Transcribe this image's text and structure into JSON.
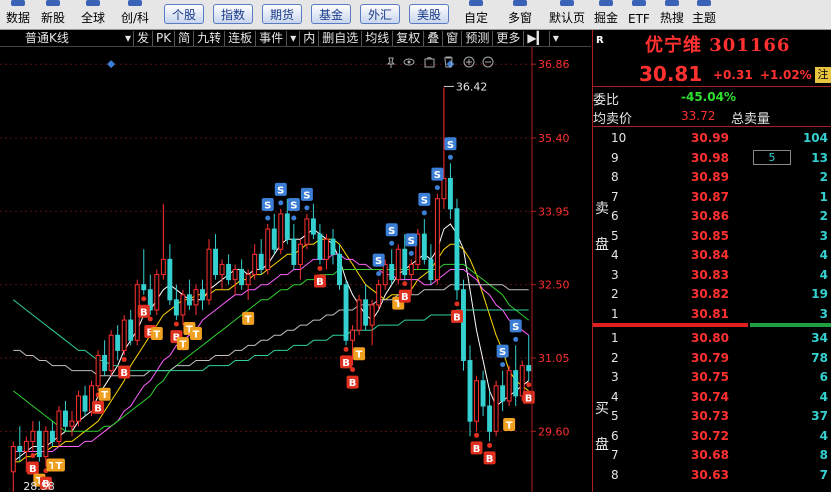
{
  "toolbar": {
    "left_items": [
      "数据",
      "新股",
      "全球",
      "创/科"
    ],
    "tabs": [
      "个股",
      "指数",
      "期货",
      "基金",
      "外汇",
      "美股"
    ],
    "right_items": [
      "自定",
      "多窗",
      "默认页",
      "掘金",
      "ETF",
      "热搜",
      "主题"
    ]
  },
  "chart_toolbar": [
    "普通K线",
    "发",
    "PK",
    "简",
    "九转",
    "连板",
    "事件",
    "内",
    "删自选",
    "均线",
    "复权",
    "叠",
    "窗",
    "预测",
    "更多"
  ],
  "chart_icons": [
    "pin-icon",
    "eye-icon",
    "bag-icon",
    "trash-icon",
    "add-icon",
    "remove-icon"
  ],
  "stock": {
    "flag": "R",
    "name": "优宁维 301166",
    "price": "30.81",
    "change": "+0.31",
    "change_pct": "+1.02%",
    "margin_badge": "注",
    "weibi_label": "委比",
    "weibi_value": "-45.04%",
    "avg_label": "均卖价",
    "avg_value": "33.72",
    "total_label": "总卖量"
  },
  "order_book": {
    "sell_label": [
      "卖",
      "盘"
    ],
    "buy_label": [
      "买",
      "盘"
    ],
    "asks": [
      {
        "level": "10",
        "price": "30.99",
        "vol": "104"
      },
      {
        "level": "9",
        "price": "30.98",
        "vol": "13",
        "box": "5"
      },
      {
        "level": "8",
        "price": "30.89",
        "vol": "2"
      },
      {
        "level": "7",
        "price": "30.87",
        "vol": "1"
      },
      {
        "level": "6",
        "price": "30.86",
        "vol": "2"
      },
      {
        "level": "5",
        "price": "30.85",
        "vol": "3"
      },
      {
        "level": "4",
        "price": "30.84",
        "vol": "4"
      },
      {
        "level": "3",
        "price": "30.83",
        "vol": "4"
      },
      {
        "level": "2",
        "price": "30.82",
        "vol": "19"
      },
      {
        "level": "1",
        "price": "30.81",
        "vol": "3"
      }
    ],
    "bids": [
      {
        "level": "1",
        "price": "30.80",
        "vol": "34"
      },
      {
        "level": "2",
        "price": "30.79",
        "vol": "78"
      },
      {
        "level": "3",
        "price": "30.75",
        "vol": "6"
      },
      {
        "level": "4",
        "price": "30.74",
        "vol": "4"
      },
      {
        "level": "5",
        "price": "30.73",
        "vol": "37"
      },
      {
        "level": "6",
        "price": "30.72",
        "vol": "4"
      },
      {
        "level": "7",
        "price": "30.68",
        "vol": "8"
      },
      {
        "level": "8",
        "price": "30.63",
        "vol": "7"
      }
    ]
  },
  "chart_data": {
    "type": "candlestick",
    "y_ticks": [
      "36.86",
      "35.40",
      "33.95",
      "32.50",
      "31.05",
      "29.60"
    ],
    "ylim": [
      28.4,
      37.2
    ],
    "high_label": "36.42",
    "low_label": "28.58",
    "high_value": 36.42,
    "low_value": 28.58,
    "colors": {
      "up": "#ff3030",
      "down": "#35d0d0",
      "ma5": "#ffffff",
      "ma10": "#ffd700",
      "ma20": "#ff60ff",
      "ma30": "#30d030",
      "ma60": "#c0c0c0",
      "ma120": "#30d0a0"
    },
    "ohlc": [
      [
        28.8,
        29.4,
        28.4,
        29.3
      ],
      [
        29.3,
        29.7,
        29.0,
        29.2
      ],
      [
        29.2,
        29.5,
        28.8,
        29.4
      ],
      [
        29.4,
        29.8,
        29.2,
        29.6
      ],
      [
        29.6,
        29.8,
        29.0,
        29.1
      ],
      [
        29.1,
        29.7,
        28.9,
        29.6
      ],
      [
        29.6,
        29.8,
        29.3,
        29.4
      ],
      [
        29.4,
        30.1,
        29.3,
        30.0
      ],
      [
        30.0,
        30.2,
        29.6,
        29.7
      ],
      [
        29.7,
        30.0,
        29.5,
        29.8
      ],
      [
        29.8,
        30.4,
        29.7,
        30.3
      ],
      [
        30.3,
        30.5,
        29.9,
        30.0
      ],
      [
        30.0,
        30.6,
        29.9,
        30.5
      ],
      [
        30.5,
        31.2,
        30.4,
        31.1
      ],
      [
        31.1,
        31.4,
        30.7,
        30.8
      ],
      [
        30.8,
        31.6,
        30.7,
        31.5
      ],
      [
        31.5,
        31.7,
        31.0,
        31.2
      ],
      [
        31.2,
        31.9,
        31.1,
        31.8
      ],
      [
        31.8,
        32.0,
        31.3,
        31.4
      ],
      [
        31.4,
        32.6,
        31.3,
        32.5
      ],
      [
        32.5,
        33.2,
        32.3,
        32.4
      ],
      [
        32.4,
        32.7,
        31.9,
        32.0
      ],
      [
        32.0,
        32.8,
        31.9,
        32.7
      ],
      [
        32.7,
        34.1,
        32.6,
        33.0
      ],
      [
        33.0,
        33.3,
        32.1,
        32.2
      ],
      [
        32.2,
        32.5,
        31.8,
        31.9
      ],
      [
        31.9,
        32.4,
        31.7,
        32.3
      ],
      [
        32.3,
        32.6,
        32.0,
        32.1
      ],
      [
        32.1,
        32.5,
        31.9,
        32.4
      ],
      [
        32.4,
        32.6,
        32.0,
        32.2
      ],
      [
        32.2,
        33.4,
        32.1,
        33.2
      ],
      [
        33.2,
        33.5,
        32.6,
        32.7
      ],
      [
        32.7,
        33.0,
        32.4,
        32.9
      ],
      [
        32.9,
        33.1,
        32.5,
        32.6
      ],
      [
        32.6,
        32.9,
        32.3,
        32.8
      ],
      [
        32.8,
        33.0,
        32.4,
        32.5
      ],
      [
        32.5,
        32.8,
        32.2,
        32.7
      ],
      [
        32.7,
        33.3,
        32.6,
        33.1
      ],
      [
        33.1,
        33.4,
        32.7,
        32.8
      ],
      [
        32.8,
        33.7,
        32.7,
        33.6
      ],
      [
        33.6,
        33.9,
        33.1,
        33.2
      ],
      [
        33.2,
        34.0,
        33.1,
        33.9
      ],
      [
        33.9,
        34.2,
        33.3,
        33.4
      ],
      [
        33.4,
        33.7,
        32.8,
        32.9
      ],
      [
        32.9,
        33.4,
        32.6,
        33.3
      ],
      [
        33.3,
        33.9,
        33.2,
        33.8
      ],
      [
        33.8,
        34.1,
        33.4,
        33.5
      ],
      [
        33.5,
        33.7,
        32.9,
        33.0
      ],
      [
        33.0,
        33.5,
        32.8,
        33.4
      ],
      [
        33.4,
        33.6,
        32.9,
        33.1
      ],
      [
        33.1,
        33.3,
        32.4,
        32.5
      ],
      [
        32.5,
        32.6,
        31.3,
        31.4
      ],
      [
        31.4,
        31.7,
        30.9,
        31.6
      ],
      [
        31.6,
        32.3,
        31.5,
        32.2
      ],
      [
        32.2,
        32.5,
        31.6,
        31.7
      ],
      [
        31.7,
        32.2,
        31.3,
        32.1
      ],
      [
        32.1,
        32.6,
        32.0,
        32.5
      ],
      [
        32.5,
        33.0,
        32.4,
        32.9
      ],
      [
        32.9,
        33.2,
        32.5,
        32.6
      ],
      [
        32.6,
        33.3,
        32.5,
        33.2
      ],
      [
        33.2,
        33.5,
        32.6,
        32.7
      ],
      [
        32.7,
        33.0,
        32.3,
        32.9
      ],
      [
        32.9,
        33.6,
        32.8,
        33.5
      ],
      [
        33.5,
        33.8,
        32.9,
        33.0
      ],
      [
        33.0,
        33.3,
        32.5,
        32.6
      ],
      [
        32.6,
        34.3,
        32.5,
        34.2
      ],
      [
        34.2,
        36.4,
        34.0,
        34.6
      ],
      [
        34.6,
        34.9,
        33.8,
        34.0
      ],
      [
        34.0,
        34.2,
        32.2,
        32.4
      ],
      [
        32.4,
        32.6,
        30.8,
        31.0
      ],
      [
        31.0,
        31.3,
        29.5,
        29.8
      ],
      [
        29.8,
        30.7,
        29.6,
        30.6
      ],
      [
        30.6,
        30.8,
        29.9,
        30.1
      ],
      [
        30.1,
        30.4,
        29.4,
        29.6
      ],
      [
        29.6,
        30.6,
        29.5,
        30.5
      ],
      [
        30.5,
        30.8,
        30.0,
        30.2
      ],
      [
        30.2,
        30.9,
        30.1,
        30.8
      ],
      [
        30.8,
        31.3,
        30.1,
        30.3
      ],
      [
        30.3,
        31.0,
        30.2,
        30.9
      ],
      [
        30.9,
        31.5,
        30.6,
        30.8
      ]
    ],
    "ma_series": [
      {
        "name": "MA5",
        "color": "#ffffff",
        "values": [
          29.0,
          29.1,
          29.2,
          29.3,
          29.3,
          29.3,
          29.4,
          29.5,
          29.6,
          29.6,
          29.8,
          29.9,
          30.0,
          30.3,
          30.5,
          30.7,
          30.9,
          31.2,
          31.4,
          31.6,
          31.9,
          32.0,
          32.2,
          32.4,
          32.5,
          32.4,
          32.3,
          32.2,
          32.2,
          32.2,
          32.4,
          32.5,
          32.6,
          32.7,
          32.8,
          32.8,
          32.7,
          32.8,
          32.8,
          32.9,
          33.1,
          33.3,
          33.4,
          33.4,
          33.4,
          33.5,
          33.6,
          33.5,
          33.4,
          33.3,
          33.0,
          32.6,
          32.3,
          32.1,
          31.9,
          31.8,
          32.0,
          32.3,
          32.5,
          32.7,
          32.8,
          32.9,
          33.0,
          33.1,
          33.0,
          33.2,
          33.6,
          33.7,
          33.5,
          33.2,
          32.4,
          31.6,
          31.0,
          30.4,
          30.1,
          30.2,
          30.3,
          30.4,
          30.5,
          30.6
        ]
      },
      {
        "name": "MA10",
        "color": "#ffd700",
        "values": [
          29.0,
          29.0,
          29.1,
          29.1,
          29.2,
          29.2,
          29.3,
          29.3,
          29.4,
          29.4,
          29.5,
          29.6,
          29.7,
          29.8,
          30.0,
          30.2,
          30.4,
          30.6,
          30.9,
          31.1,
          31.3,
          31.5,
          31.7,
          31.9,
          32.0,
          32.1,
          32.2,
          32.2,
          32.3,
          32.3,
          32.3,
          32.4,
          32.4,
          32.4,
          32.5,
          32.6,
          32.6,
          32.7,
          32.7,
          32.8,
          32.9,
          33.0,
          33.1,
          33.1,
          33.2,
          33.3,
          33.3,
          33.4,
          33.4,
          33.4,
          33.3,
          33.1,
          32.9,
          32.7,
          32.5,
          32.4,
          32.3,
          32.2,
          32.3,
          32.3,
          32.3,
          32.4,
          32.6,
          32.7,
          32.8,
          33.0,
          33.2,
          33.3,
          33.3,
          33.2,
          33.0,
          32.7,
          32.3,
          31.9,
          31.5,
          31.2,
          30.8,
          30.6,
          30.5,
          30.4
        ]
      },
      {
        "name": "MA20",
        "color": "#ff60ff",
        "values": [
          29.2,
          29.2,
          29.2,
          29.2,
          29.2,
          29.2,
          29.2,
          29.3,
          29.3,
          29.3,
          29.3,
          29.4,
          29.4,
          29.5,
          29.6,
          29.7,
          29.8,
          30.0,
          30.1,
          30.3,
          30.5,
          30.6,
          30.8,
          31.0,
          31.1,
          31.3,
          31.4,
          31.5,
          31.6,
          31.8,
          31.9,
          32.0,
          32.1,
          32.2,
          32.3,
          32.3,
          32.4,
          32.4,
          32.5,
          32.5,
          32.6,
          32.7,
          32.7,
          32.8,
          32.8,
          32.9,
          33.0,
          33.0,
          33.0,
          33.1,
          33.1,
          33.0,
          33.0,
          32.9,
          32.9,
          32.8,
          32.8,
          32.7,
          32.7,
          32.6,
          32.6,
          32.6,
          32.6,
          32.5,
          32.5,
          32.6,
          32.7,
          32.8,
          32.8,
          32.8,
          32.7,
          32.6,
          32.4,
          32.3,
          32.1,
          32.0,
          31.8,
          31.7,
          31.6,
          31.5
        ]
      },
      {
        "name": "MA30",
        "color": "#30d030",
        "values": [
          30.4,
          30.3,
          30.2,
          30.1,
          30.0,
          29.9,
          29.8,
          29.7,
          29.6,
          29.6,
          29.6,
          29.6,
          29.6,
          29.6,
          29.7,
          29.7,
          29.8,
          29.9,
          30.0,
          30.1,
          30.2,
          30.3,
          30.5,
          30.6,
          30.8,
          30.9,
          31.0,
          31.1,
          31.2,
          31.3,
          31.4,
          31.5,
          31.6,
          31.7,
          31.8,
          31.9,
          32.0,
          32.1,
          32.2,
          32.2,
          32.3,
          32.4,
          32.4,
          32.5,
          32.5,
          32.6,
          32.6,
          32.7,
          32.7,
          32.7,
          32.8,
          32.8,
          32.8,
          32.8,
          32.8,
          32.8,
          32.8,
          32.8,
          32.8,
          32.8,
          32.8,
          32.8,
          32.8,
          32.8,
          32.8,
          32.8,
          32.9,
          32.9,
          32.9,
          32.9,
          32.8,
          32.7,
          32.6,
          32.5,
          32.4,
          32.3,
          32.1,
          32.0,
          31.9,
          31.8
        ]
      },
      {
        "name": "MA60",
        "color": "#c0c0c0",
        "values": [
          31.2,
          31.2,
          31.1,
          31.1,
          31.0,
          31.0,
          30.9,
          30.9,
          30.9,
          30.8,
          30.8,
          30.8,
          30.8,
          30.7,
          30.7,
          30.7,
          30.7,
          30.7,
          30.7,
          30.7,
          30.7,
          30.8,
          30.8,
          30.8,
          30.8,
          30.9,
          30.9,
          30.9,
          31.0,
          31.0,
          31.0,
          31.1,
          31.1,
          31.1,
          31.2,
          31.2,
          31.3,
          31.3,
          31.4,
          31.4,
          31.5,
          31.5,
          31.6,
          31.6,
          31.7,
          31.7,
          31.8,
          31.8,
          31.9,
          31.9,
          32.0,
          32.0,
          32.0,
          32.1,
          32.1,
          32.1,
          32.2,
          32.2,
          32.2,
          32.3,
          32.3,
          32.3,
          32.3,
          32.4,
          32.4,
          32.4,
          32.4,
          32.5,
          32.5,
          32.5,
          32.5,
          32.5,
          32.5,
          32.5,
          32.5,
          32.5,
          32.4,
          32.4,
          32.4,
          32.4
        ]
      },
      {
        "name": "MA120",
        "color": "#30d0a0",
        "values": [
          32.2,
          32.1,
          32.0,
          31.9,
          31.8,
          31.7,
          31.6,
          31.5,
          31.4,
          31.3,
          31.2,
          31.2,
          31.1,
          31.0,
          31.0,
          30.9,
          30.9,
          30.8,
          30.8,
          30.8,
          30.8,
          30.8,
          30.8,
          30.8,
          30.8,
          30.8,
          30.8,
          30.8,
          30.8,
          30.8,
          30.9,
          30.9,
          30.9,
          30.9,
          31.0,
          31.0,
          31.0,
          31.1,
          31.1,
          31.1,
          31.2,
          31.2,
          31.2,
          31.3,
          31.3,
          31.3,
          31.4,
          31.4,
          31.4,
          31.5,
          31.5,
          31.5,
          31.6,
          31.6,
          31.6,
          31.6,
          31.7,
          31.7,
          31.7,
          31.7,
          31.8,
          31.8,
          31.8,
          31.8,
          31.9,
          31.9,
          31.9,
          31.9,
          32.0,
          32.0,
          32.0,
          32.0,
          32.0,
          32.0,
          32.0,
          32.0,
          32.0,
          32.0,
          32.0,
          32.0
        ]
      }
    ],
    "signals": [
      {
        "type": "B",
        "i": 0
      },
      {
        "type": "B",
        "i": 3
      },
      {
        "type": "T",
        "i": 4
      },
      {
        "type": "B",
        "i": 5
      },
      {
        "type": "T",
        "i": 6
      },
      {
        "type": "T",
        "i": 7
      },
      {
        "type": "B",
        "i": 13
      },
      {
        "type": "T",
        "i": 14
      },
      {
        "type": "B",
        "i": 17
      },
      {
        "type": "B",
        "i": 20
      },
      {
        "type": "B",
        "i": 21
      },
      {
        "type": "T",
        "i": 22
      },
      {
        "type": "B",
        "i": 25
      },
      {
        "type": "T",
        "i": 26
      },
      {
        "type": "T",
        "i": 27
      },
      {
        "type": "T",
        "i": 28
      },
      {
        "type": "T",
        "i": 36
      },
      {
        "type": "S",
        "i": 39
      },
      {
        "type": "S",
        "i": 41
      },
      {
        "type": "S",
        "i": 43
      },
      {
        "type": "S",
        "i": 45
      },
      {
        "type": "B",
        "i": 47
      },
      {
        "type": "B",
        "i": 51
      },
      {
        "type": "B",
        "i": 52
      },
      {
        "type": "T",
        "i": 53
      },
      {
        "type": "S",
        "i": 56
      },
      {
        "type": "S",
        "i": 58
      },
      {
        "type": "T",
        "i": 59
      },
      {
        "type": "B",
        "i": 60
      },
      {
        "type": "S",
        "i": 61
      },
      {
        "type": "S",
        "i": 63
      },
      {
        "type": "S",
        "i": 65
      },
      {
        "type": "S",
        "i": 67
      },
      {
        "type": "B",
        "i": 68
      },
      {
        "type": "B",
        "i": 71
      },
      {
        "type": "B",
        "i": 73
      },
      {
        "type": "S",
        "i": 75
      },
      {
        "type": "T",
        "i": 76
      },
      {
        "type": "S",
        "i": 77
      },
      {
        "type": "B",
        "i": 79
      }
    ]
  }
}
